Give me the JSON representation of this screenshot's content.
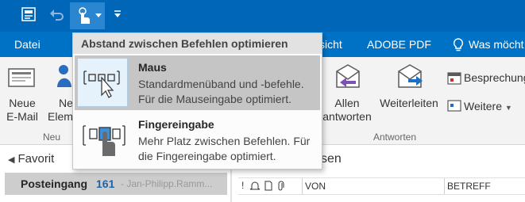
{
  "titlebar": {
    "icons": [
      "send-receive-icon",
      "undo-icon",
      "touch-mode-icon",
      "customize-qat-icon"
    ]
  },
  "menubar": {
    "tabs": [
      "Datei",
      "sicht",
      "ADOBE PDF",
      "Was möcht"
    ]
  },
  "ribbon": {
    "buttons": {
      "new_email": [
        "Neue",
        "E-Mail"
      ],
      "new_items": [
        "Ne",
        "Eleme"
      ],
      "reply_all": [
        "Allen",
        "antworten"
      ],
      "forward": "Weiterleiten",
      "meeting": "Besprechung",
      "more": "Weitere"
    },
    "groups": {
      "new": "Neu",
      "respond": "Antworten"
    }
  },
  "dropdown": {
    "header": "Abstand zwischen Befehlen optimieren",
    "items": [
      {
        "title": "Maus",
        "desc": "Standardmenüband und -befehle. Für die Mauseingabe optimiert.",
        "selected": true
      },
      {
        "title": "Fingereingabe",
        "desc": "Mehr Platz zwischen Befehlen. Für die Fingereingabe optimiert.",
        "selected": false
      }
    ]
  },
  "leftpane": {
    "favorites": "Favorit",
    "inbox_label": "Posteingang",
    "inbox_count": "161",
    "inbox_account": "- Jan-Philipp.Ramm..."
  },
  "rightpane": {
    "title_fragment": "sen",
    "col_from": "VON",
    "col_subject": "BETREFF"
  },
  "colors": {
    "titlebar": "#0067b8",
    "menubar": "#0072c6",
    "selected_item": "#c5c5c5",
    "inbox_count": "#1e64a8"
  }
}
